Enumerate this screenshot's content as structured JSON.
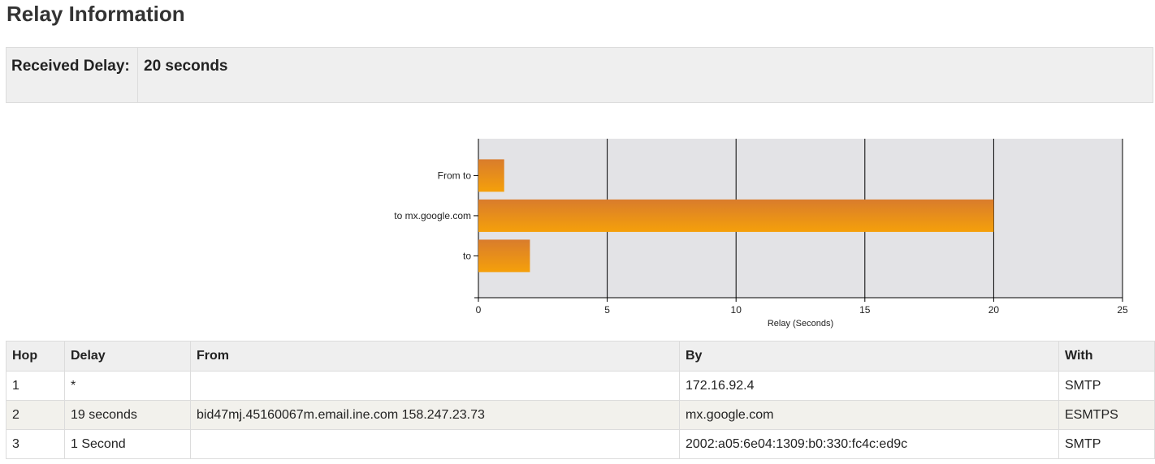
{
  "page": {
    "title": "Relay Information"
  },
  "summary": {
    "label": "Received Delay:",
    "value": "20 seconds"
  },
  "chart_data": {
    "type": "bar",
    "orientation": "horizontal",
    "categories": [
      "From  to",
      "to mx.google.com",
      "to"
    ],
    "values": [
      1,
      20,
      2
    ],
    "xlabel": "Relay (Seconds)",
    "ylabel": "",
    "xlim": [
      0,
      25
    ],
    "ticks": [
      0,
      5,
      10,
      15,
      20,
      25
    ],
    "grid": true,
    "colors": {
      "bar_top": "#d97c2c",
      "bar_bottom": "#f5a00a",
      "plot_bg": "#e3e3e6"
    }
  },
  "table": {
    "headers": [
      "Hop",
      "Delay",
      "From",
      "By",
      "With"
    ],
    "rows": [
      [
        "1",
        "*",
        "",
        "172.16.92.4",
        "SMTP"
      ],
      [
        "2",
        "19 seconds",
        "bid47mj.45160067m.email.ine.com 158.247.23.73",
        "mx.google.com",
        "ESMTPS"
      ],
      [
        "3",
        "1 Second",
        "",
        "2002:a05:6e04:1309:b0:330:fc4c:ed9c",
        "SMTP"
      ]
    ]
  }
}
